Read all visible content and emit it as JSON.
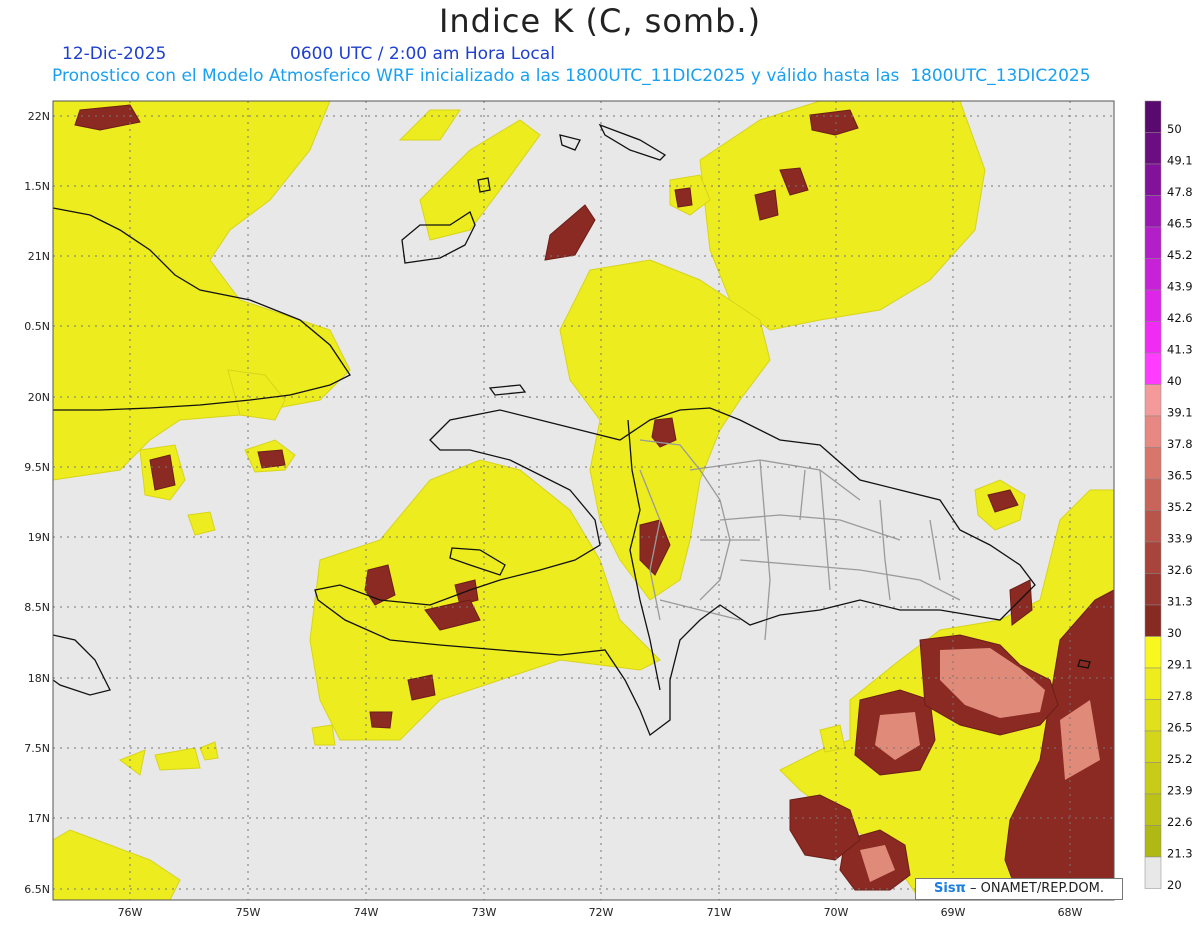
{
  "header": {
    "title": "Indice K (C, somb.)",
    "date": "12-Dic-2025",
    "time": "0600 UTC / 2:00 am Hora Local",
    "description": "Pronostico con el Modelo Atmosferico WRF inicializado a las 1800UTC_11DIC2025 y válido hasta las  1800UTC_13DIC2025"
  },
  "map": {
    "lat_labels": [
      "22N",
      "1.5N",
      "21N",
      "0.5N",
      "20N",
      "9.5N",
      "19N",
      "8.5N",
      "18N",
      "7.5N",
      "17N",
      "6.5N"
    ],
    "lon_labels": [
      "76W",
      "75W",
      "74W",
      "73W",
      "72W",
      "71W",
      "70W",
      "69W",
      "68W"
    ],
    "lat_range": [
      16.4,
      22.1
    ],
    "lon_range": [
      -76.65,
      -67.6
    ],
    "grid": true,
    "colors": {
      "background_no_data": "#e8e8e8",
      "coastline": "#111111",
      "provinces": "#9a9a9a"
    }
  },
  "colorbar": {
    "labels": [
      "50",
      "49.1",
      "47.8",
      "46.5",
      "45.2",
      "43.9",
      "42.6",
      "41.3",
      "40",
      "39.1",
      "37.8",
      "36.5",
      "35.2",
      "33.9",
      "32.6",
      "31.3",
      "30",
      "29.1",
      "27.8",
      "26.5",
      "25.2",
      "23.9",
      "22.6",
      "21.3",
      "20"
    ],
    "colors": [
      "#5a0a6e",
      "#6b0e82",
      "#82129a",
      "#9a18b2",
      "#b21ec8",
      "#c822d8",
      "#de26e8",
      "#f02cf4",
      "#ff3cff",
      "#f49a9a",
      "#e88882",
      "#d8766c",
      "#c8645a",
      "#b8544a",
      "#a8443c",
      "#983630",
      "#862a22",
      "#f8f820",
      "#ecec1e",
      "#e0e01c",
      "#d4d61a",
      "#c8cc18",
      "#bcc216",
      "#b0b814",
      "#e8e8e8"
    ]
  },
  "credit": {
    "sis": "Sisπ",
    "rest": " – ONAMET/REP.DOM."
  }
}
